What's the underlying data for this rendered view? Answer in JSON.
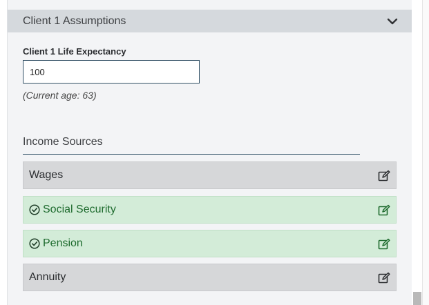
{
  "section": {
    "title": "Client 1 Assumptions",
    "icon": "chevron-down-icon"
  },
  "life_expectancy": {
    "label": "Client 1 Life Expectancy",
    "value": "100",
    "note": "(Current age: 63)"
  },
  "income_sources": {
    "title": "Income Sources",
    "items": [
      {
        "label": "Wages",
        "status": "incomplete",
        "edit_icon": "edit-icon"
      },
      {
        "label": "Social Security",
        "status": "complete",
        "status_icon": "check-circle-icon",
        "edit_icon": "edit-icon"
      },
      {
        "label": "Pension",
        "status": "complete",
        "status_icon": "check-circle-icon",
        "edit_icon": "edit-icon"
      },
      {
        "label": "Annuity",
        "status": "incomplete",
        "edit_icon": "edit-icon"
      }
    ]
  },
  "colors": {
    "header_bg": "#d5d9dd",
    "complete_bg": "#d3ecd8",
    "complete_text": "#1e6b2e",
    "incomplete_bg": "#d6d7d9",
    "accent_line": "#2e4d63"
  }
}
